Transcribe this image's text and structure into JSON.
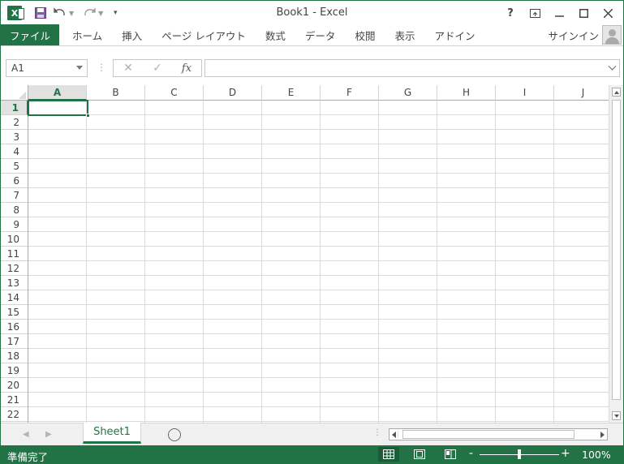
{
  "window": {
    "title": "Book1 - Excel",
    "app_icon": "excel-logo-icon",
    "qat": [
      "save-icon",
      "undo-icon",
      "redo-icon",
      "customize-qat-icon"
    ],
    "controls": {
      "help": "?",
      "ribbon_display": "restore-ribbon-icon",
      "minimize": "minimize-icon",
      "maximize": "maximize-icon",
      "close": "close-icon"
    }
  },
  "ribbon": {
    "tabs": [
      {
        "label": "ファイル",
        "kind": "file"
      },
      {
        "label": "ホーム"
      },
      {
        "label": "挿入"
      },
      {
        "label": "ページ レイアウト"
      },
      {
        "label": "数式"
      },
      {
        "label": "データ"
      },
      {
        "label": "校閲"
      },
      {
        "label": "表示"
      },
      {
        "label": "アドイン"
      }
    ],
    "signin_label": "サインイン"
  },
  "formula_bar": {
    "name_box": "A1",
    "cancel_icon": "✕",
    "enter_icon": "✓",
    "fx_label": "fx",
    "content": ""
  },
  "sheet": {
    "columns": [
      "A",
      "B",
      "C",
      "D",
      "E",
      "F",
      "G",
      "H",
      "I",
      "J"
    ],
    "rows": [
      "1",
      "2",
      "3",
      "4",
      "5",
      "6",
      "7",
      "8",
      "9",
      "10",
      "11",
      "12",
      "13",
      "14",
      "15",
      "16",
      "17",
      "18",
      "19",
      "20",
      "21",
      "22"
    ],
    "active_cell": "A1",
    "selected_column": "A",
    "selected_row": "1"
  },
  "sheet_tabs": {
    "tabs": [
      "Sheet1"
    ],
    "active": "Sheet1",
    "add_icon": "⊕"
  },
  "status_bar": {
    "status": "準備完了",
    "views": [
      "normal-view-icon",
      "page-layout-view-icon",
      "page-break-preview-icon"
    ],
    "zoom_minus": "-",
    "zoom_plus": "+",
    "zoom_level": "100%",
    "zoom_fraction": 0.5
  },
  "colors": {
    "accent": "#217346",
    "gridline": "#dadada",
    "header_selected_bg": "#e1e1e1"
  }
}
